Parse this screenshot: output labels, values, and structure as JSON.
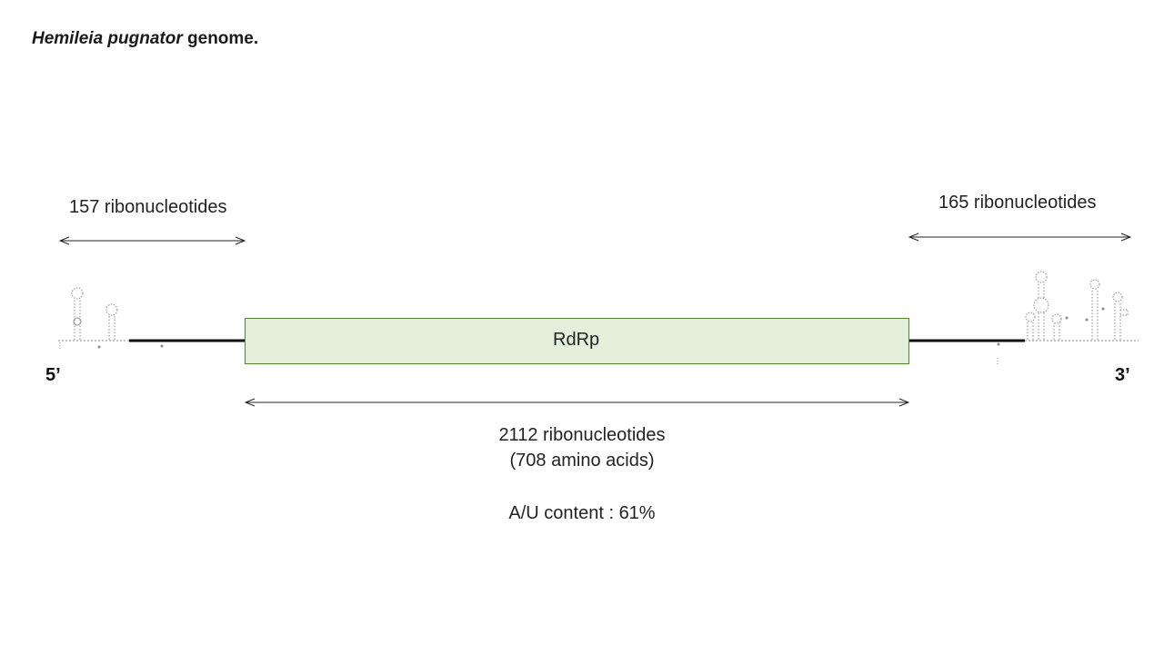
{
  "title": {
    "species": "Hemileia pugnator",
    "suffix": " genome."
  },
  "utr5": {
    "length_label": "157 ribonucleotides",
    "end_label": "5’"
  },
  "utr3": {
    "length_label": "165 ribonucleotides",
    "end_label": "3’"
  },
  "orf": {
    "name": "RdRp",
    "length_label": "2112 ribonucleotides",
    "protein_label": "(708 amino acids)",
    "fill_color": "#e2efda",
    "border_color": "#548235"
  },
  "composition": {
    "au_content_label": "A/U content : 61%"
  }
}
